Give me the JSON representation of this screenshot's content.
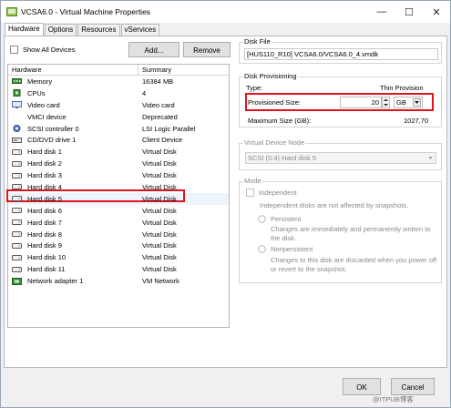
{
  "window": {
    "title": "VCSA6.0 - Virtual Machine Properties",
    "controls": {
      "minimize": "—",
      "maximize": "☐",
      "close": "✕"
    }
  },
  "tabs": [
    "Hardware",
    "Options",
    "Resources",
    "vServices"
  ],
  "hardware": {
    "show_all_label": "Show All Devices",
    "add_button": "Add...",
    "remove_button": "Remove",
    "columns": [
      "Hardware",
      "Summary"
    ],
    "rows": [
      {
        "name": "Memory",
        "summary": "16384 MB",
        "icon": "memory-icon"
      },
      {
        "name": "CPUs",
        "summary": "4",
        "icon": "cpu-icon"
      },
      {
        "name": "Video card",
        "summary": "Video card",
        "icon": "video-card-icon"
      },
      {
        "name": "VMCI device",
        "summary": "Deprecated",
        "icon": "vmci-icon"
      },
      {
        "name": "SCSI controller 0",
        "summary": "LSI Logic Parallel",
        "icon": "scsi-controller-icon"
      },
      {
        "name": "CD/DVD drive 1",
        "summary": "Client Device",
        "icon": "cd-dvd-icon"
      },
      {
        "name": "Hard disk 1",
        "summary": "Virtual Disk",
        "icon": "hard-disk-icon"
      },
      {
        "name": "Hard disk 2",
        "summary": "Virtual Disk",
        "icon": "hard-disk-icon"
      },
      {
        "name": "Hard disk 3",
        "summary": "Virtual Disk",
        "icon": "hard-disk-icon"
      },
      {
        "name": "Hard disk 4",
        "summary": "Virtual Disk",
        "icon": "hard-disk-icon"
      },
      {
        "name": "Hard disk 5",
        "summary": "Virtual Disk",
        "icon": "hard-disk-icon",
        "selected": true
      },
      {
        "name": "Hard disk 6",
        "summary": "Virtual Disk",
        "icon": "hard-disk-icon"
      },
      {
        "name": "Hard disk 7",
        "summary": "Virtual Disk",
        "icon": "hard-disk-icon"
      },
      {
        "name": "Hard disk 8",
        "summary": "Virtual Disk",
        "icon": "hard-disk-icon"
      },
      {
        "name": "Hard disk 9",
        "summary": "Virtual Disk",
        "icon": "hard-disk-icon"
      },
      {
        "name": "Hard disk 10",
        "summary": "Virtual Disk",
        "icon": "hard-disk-icon"
      },
      {
        "name": "Hard disk 11",
        "summary": "Virtual Disk",
        "icon": "hard-disk-icon"
      },
      {
        "name": "Network adapter 1",
        "summary": "VM Network",
        "icon": "network-adapter-icon"
      }
    ]
  },
  "disk_file": {
    "title": "Disk File",
    "value": "[HUS110_R10] VCSA6.0/VCSA6.0_4.vmdk"
  },
  "provisioning": {
    "title": "Disk Provisioning",
    "type_label": "Type:",
    "type_value": "Thin Provision",
    "size_label": "Provisioned Size:",
    "size_value": "20",
    "unit": "GB",
    "max_label": "Maximum Size (GB):",
    "max_value": "1027,70"
  },
  "vdn": {
    "title": "Virtual Device Node",
    "value": "SCSI (0:4) Hard disk 5"
  },
  "mode": {
    "title": "Mode",
    "independent_label": "Independent",
    "independent_desc": "Independent disks are not affected by snapshots.",
    "persistent_label": "Persistent",
    "persistent_desc": "Changes are immediately and permanently written to the disk.",
    "nonpersistent_label": "Nonpersistent",
    "nonpersistent_desc": "Changes to this disk are discarded when you power off or revert to the snapshot."
  },
  "footer": {
    "ok": "OK",
    "cancel": "Cancel",
    "watermark": "@ITPUB博客"
  },
  "colors": {
    "highlight": "#e0141e",
    "selection": "#cce4f7"
  }
}
